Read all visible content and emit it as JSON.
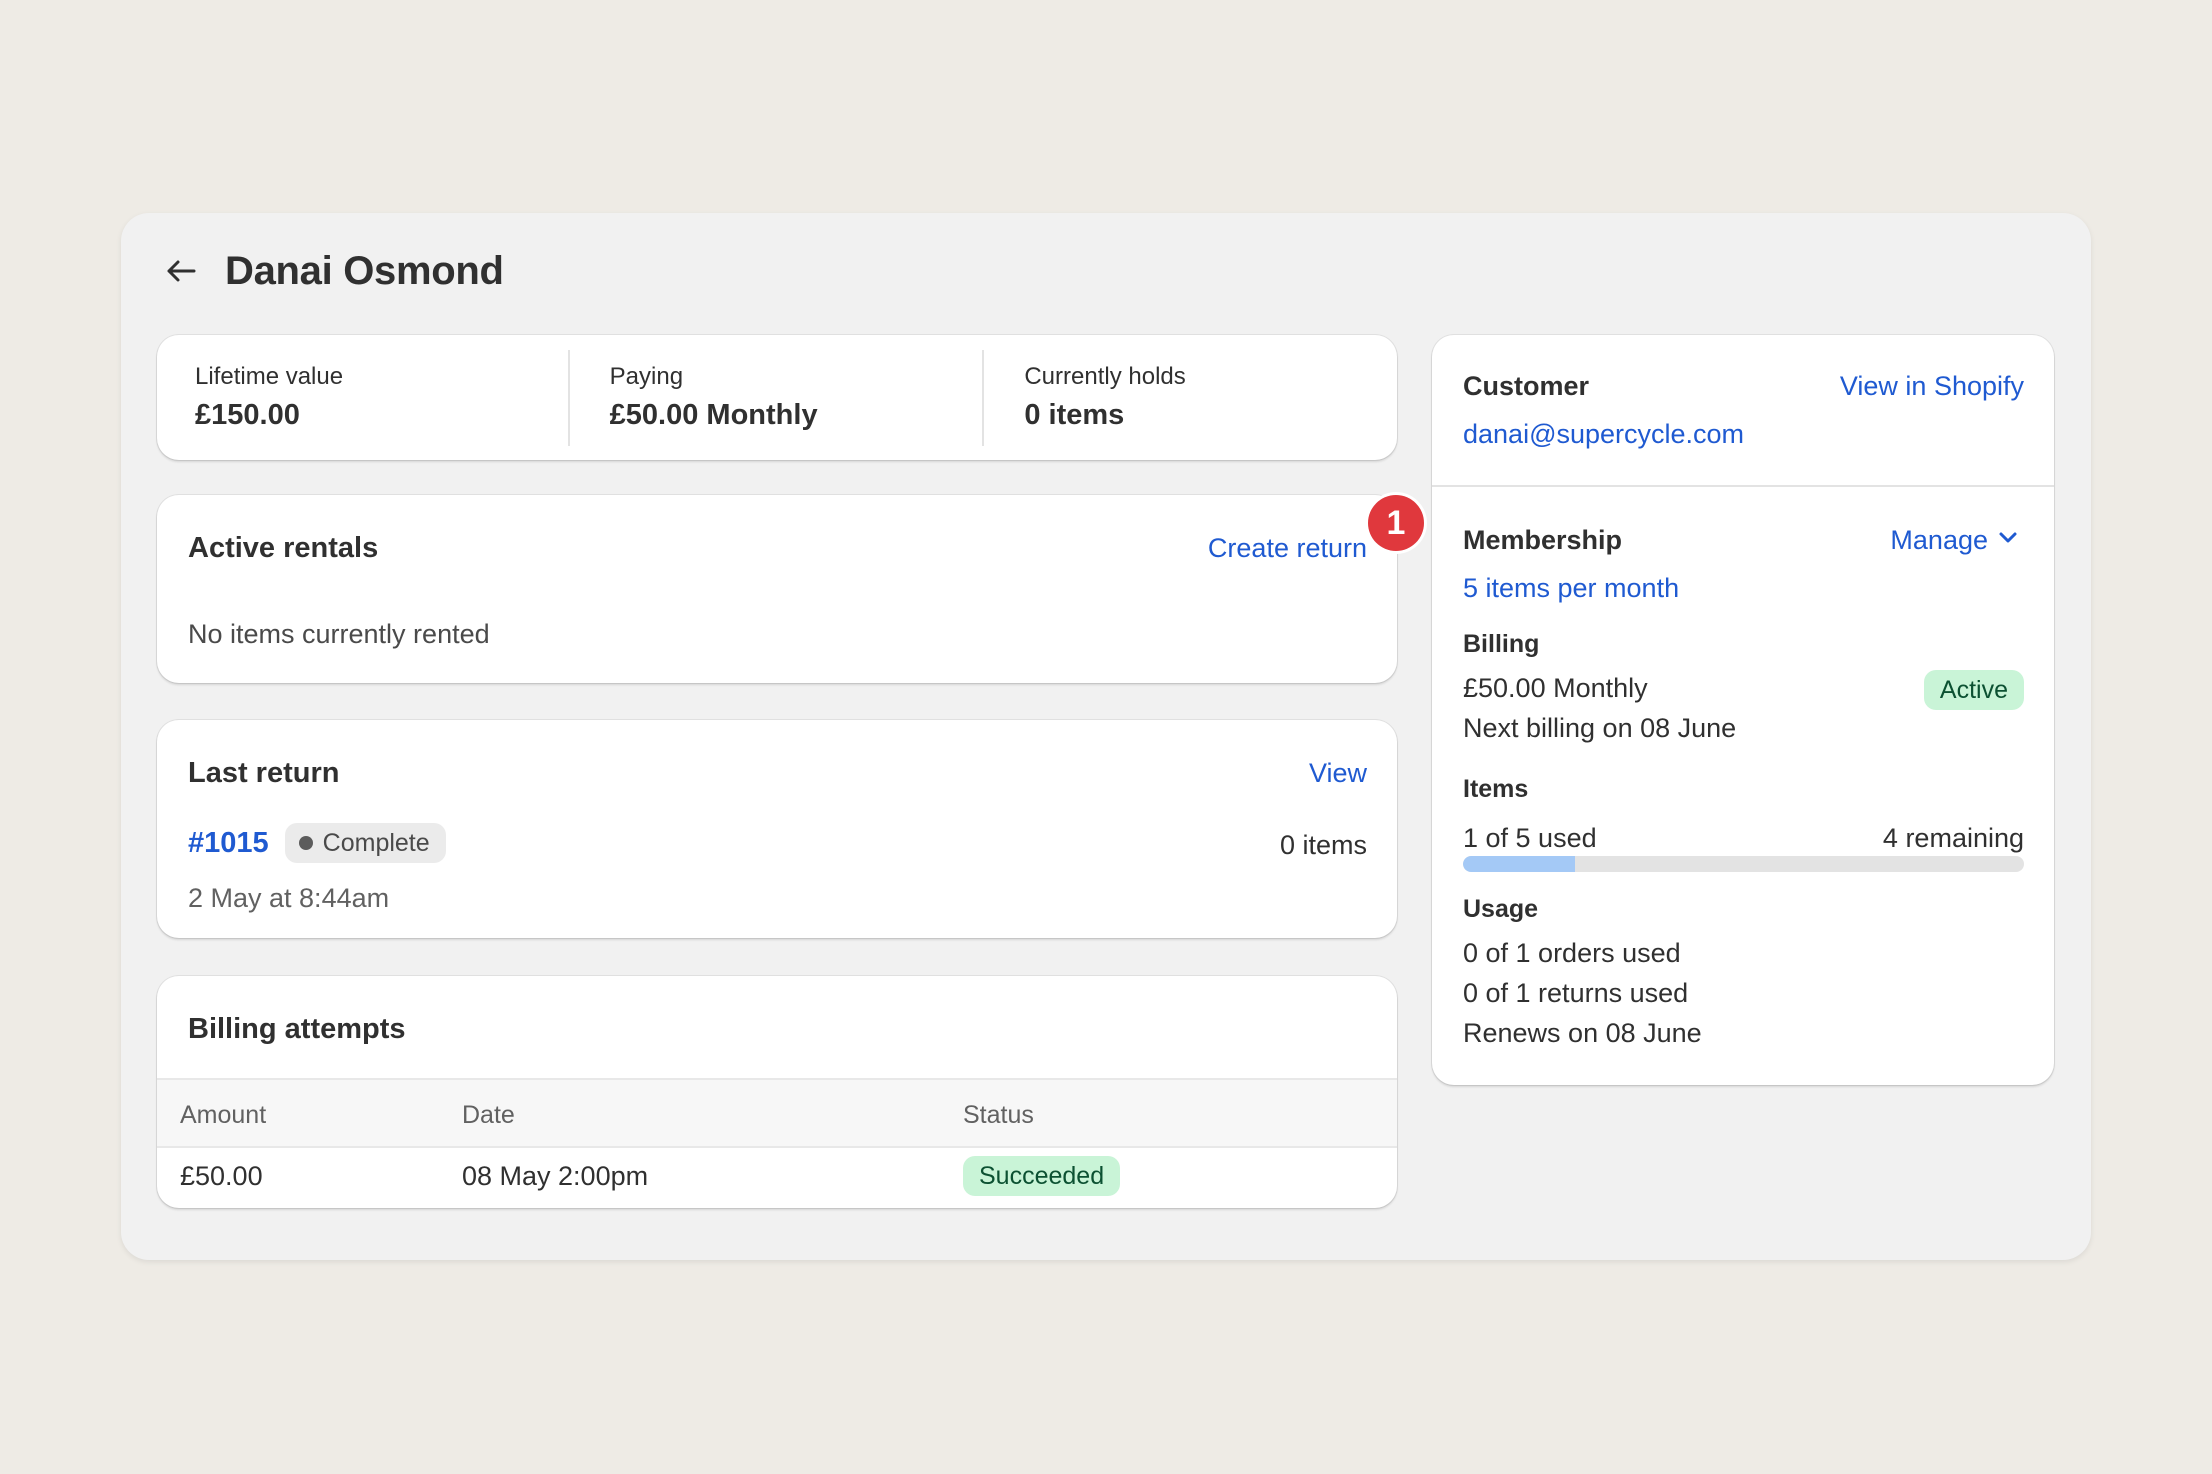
{
  "header": {
    "title": "Danai Osmond"
  },
  "stats": [
    {
      "label": "Lifetime value",
      "value": "£150.00"
    },
    {
      "label": "Paying",
      "value": "£50.00 Monthly"
    },
    {
      "label": "Currently holds",
      "value": "0 items"
    }
  ],
  "active_rentals": {
    "title": "Active rentals",
    "action": "Create return",
    "empty_text": "No items currently rented",
    "annotation_number": "1"
  },
  "last_return": {
    "title": "Last return",
    "action": "View",
    "order_number": "#1015",
    "status": "Complete",
    "items": "0 items",
    "date": "2 May at 8:44am"
  },
  "billing_attempts": {
    "title": "Billing attempts",
    "columns": [
      "Amount",
      "Date",
      "Status"
    ],
    "rows": [
      {
        "amount": "£50.00",
        "date": "08 May 2:00pm",
        "status": "Succeeded"
      }
    ]
  },
  "customer": {
    "title": "Customer",
    "action": "View in Shopify",
    "email": "danai@supercycle.com"
  },
  "membership": {
    "title": "Membership",
    "action": "Manage",
    "plan": "5 items per month",
    "billing_heading": "Billing",
    "billing_amount": "£50.00 Monthly",
    "billing_status": "Active",
    "next_billing": "Next billing on 08 June",
    "items_heading": "Items",
    "items_used": "1 of 5 used",
    "items_remaining": "4 remaining",
    "items_used_fraction": 0.2,
    "usage_heading": "Usage",
    "orders_used": "0 of 1 orders used",
    "returns_used": "0 of 1 returns used",
    "renews": "Renews on 08 June"
  },
  "colors": {
    "link": "#1f5ad1",
    "badge_red": "#e0383d",
    "success_bg": "#c9f4d7",
    "progress_fill": "#a4c9f6"
  }
}
